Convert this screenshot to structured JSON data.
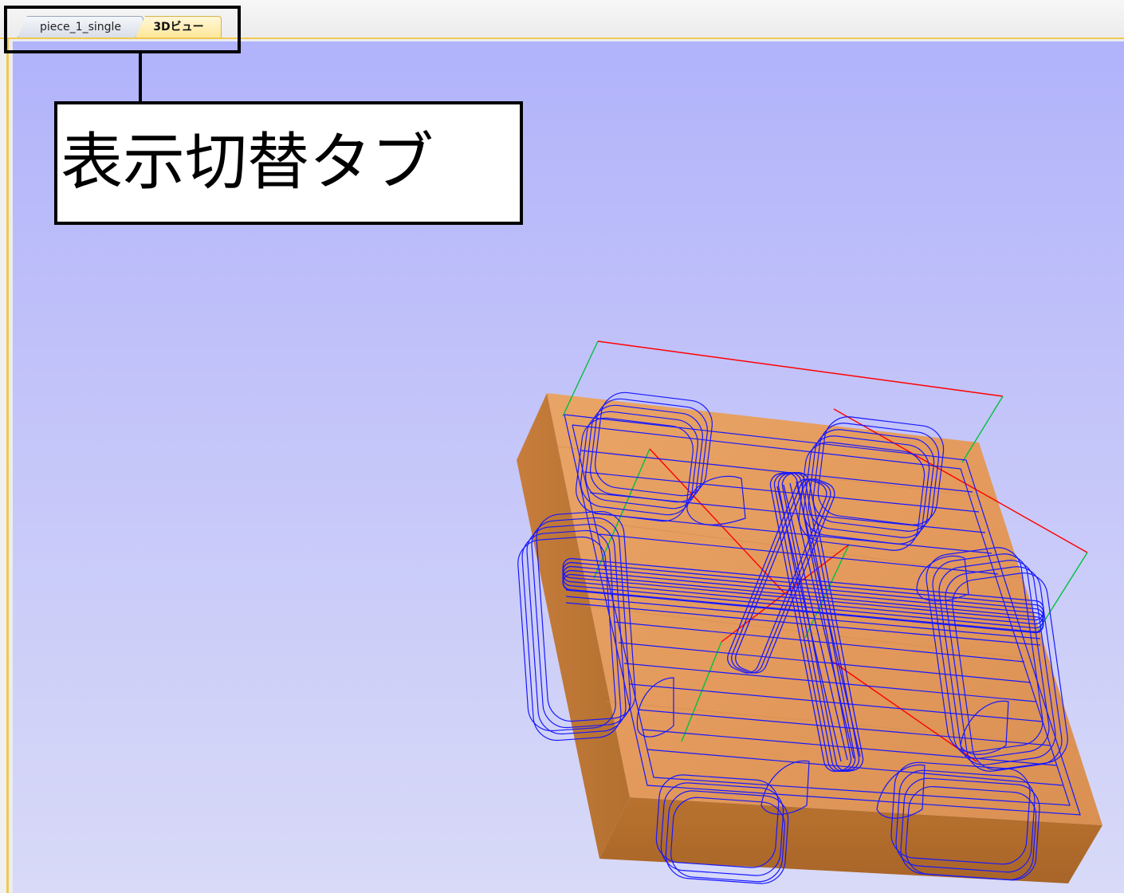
{
  "tabs": [
    {
      "label": "piece_1_single",
      "active": false
    },
    {
      "label": "3Dビュー",
      "active": true
    }
  ],
  "annotation": {
    "label": "表示切替タブ"
  },
  "colors": {
    "accent": "#f0c850",
    "background_top": "#b1b3fb",
    "background_bottom": "#d8daf8",
    "toolpath": "#1818ff",
    "wood": "#e39a5c",
    "axis_x": "#ff0000",
    "axis_y": "#00c040"
  }
}
